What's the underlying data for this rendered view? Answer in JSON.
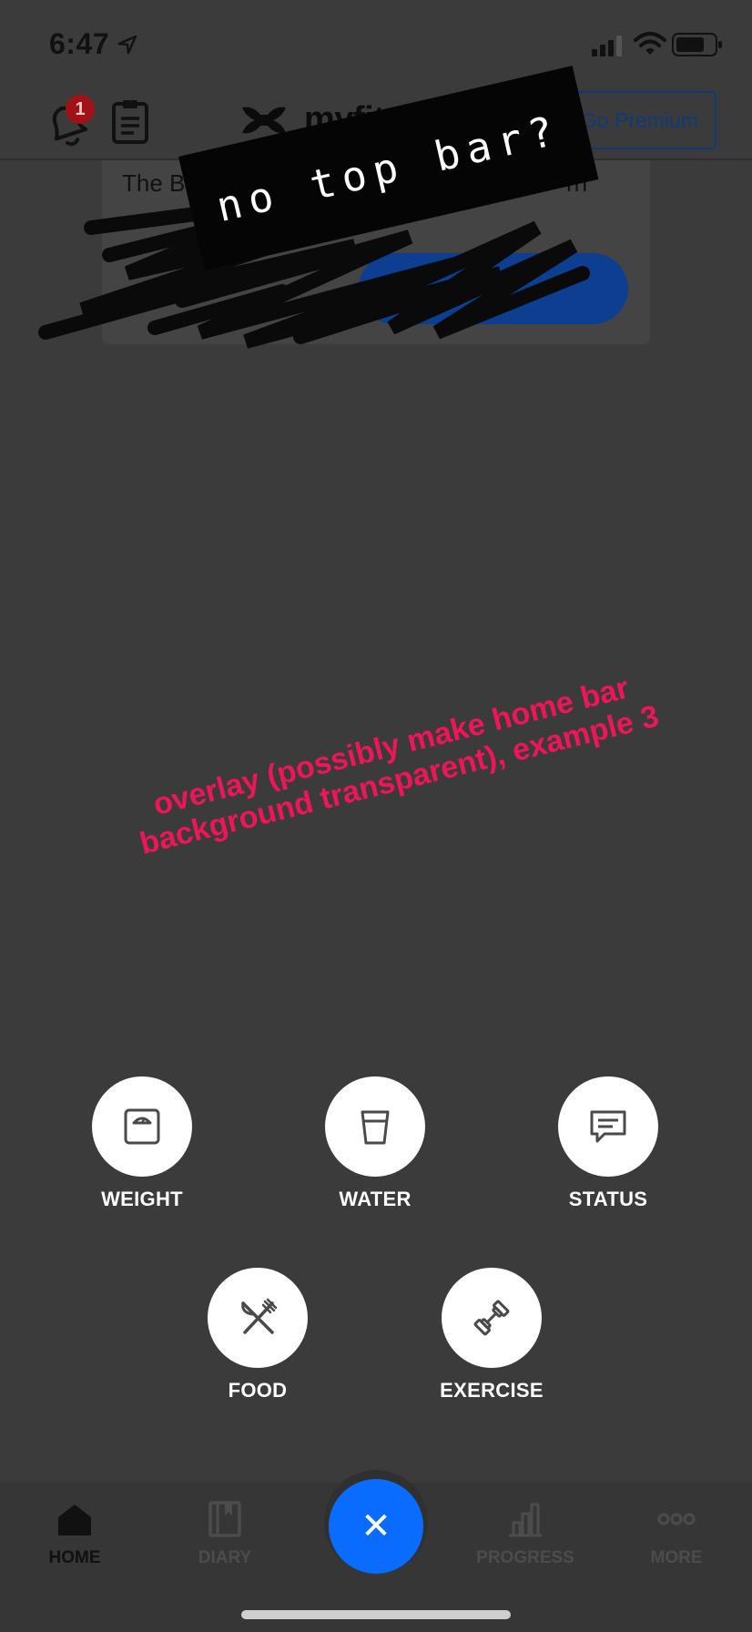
{
  "status_bar": {
    "time": "6:47"
  },
  "header": {
    "notification_count": "1",
    "logo_text": "myfitnesspal",
    "premium_label": "Go Premium"
  },
  "promo": {
    "text_left": "The Box Top",
    "text_right": "rn"
  },
  "annotations": {
    "sticker_text": "no top bar?",
    "note_text": "overlay (possibly make home bar background transparent), example 3",
    "note_color": "#ee1558"
  },
  "actions": [
    {
      "label": "WEIGHT",
      "icon": "scale-icon"
    },
    {
      "label": "WATER",
      "icon": "water-glass-icon"
    },
    {
      "label": "STATUS",
      "icon": "chat-bubble-icon"
    },
    {
      "label": "FOOD",
      "icon": "fork-knife-icon"
    },
    {
      "label": "EXERCISE",
      "icon": "dumbbell-icon"
    }
  ],
  "tabs": [
    {
      "label": "HOME",
      "icon": "home-icon",
      "active": true
    },
    {
      "label": "DIARY",
      "icon": "book-icon",
      "active": false
    },
    {
      "label": "PROGRESS",
      "icon": "bar-chart-icon",
      "active": false
    },
    {
      "label": "MORE",
      "icon": "more-dots-icon",
      "active": false
    }
  ],
  "fab": {
    "symbol": "✕",
    "color": "#0a6cff"
  }
}
